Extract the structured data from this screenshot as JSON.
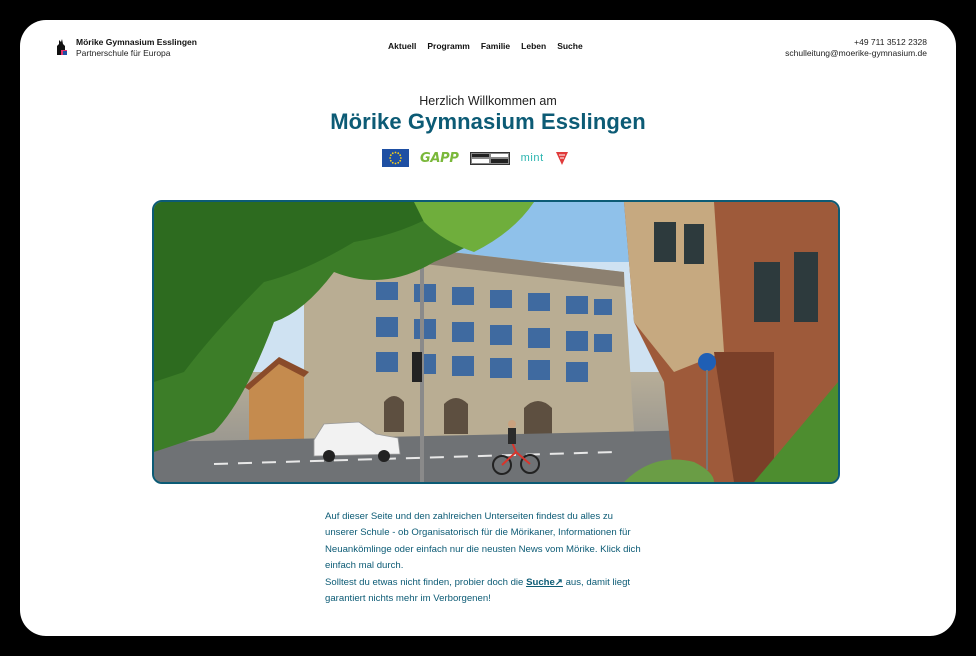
{
  "header": {
    "school_name": "Mörike Gymnasium Esslingen",
    "school_subtitle": "Partnerschule für Europa",
    "nav": [
      {
        "label": "Aktuell"
      },
      {
        "label": "Programm"
      },
      {
        "label": "Familie"
      },
      {
        "label": "Leben"
      },
      {
        "label": "Suche"
      }
    ],
    "phone": "+49 711 3512 2328",
    "email": "schulleitung@moerike-gymnasium.de"
  },
  "hero": {
    "welcome": "Herzlich Willkommen am",
    "title": "Mörike Gymnasium Esslingen"
  },
  "partners": {
    "gapp": "GAPP",
    "mint": "mint"
  },
  "intro": {
    "paragraph1": "Auf dieser Seite und den zahlreichen Unterseiten findest du alles zu unserer Schule - ob Organisatorisch für die Mörikaner, Informationen für Neuankömlinge oder einfach nur die neusten News vom Mörike. Klick dich einfach mal durch.",
    "paragraph2_before": "Solltest du etwas nicht finden, probier doch die ",
    "search_link": "Suche↗",
    "paragraph2_after": " aus, damit liegt garantiert nichts mehr im Verborgenen!"
  },
  "colors": {
    "brand": "#0c5b75",
    "gapp_green": "#7ab83a",
    "mint_teal": "#2bb5b0",
    "eu_blue": "#1e4fa3"
  },
  "icons": [
    "school-logo-icon",
    "eu-flag-icon",
    "shield-logo-icon"
  ]
}
